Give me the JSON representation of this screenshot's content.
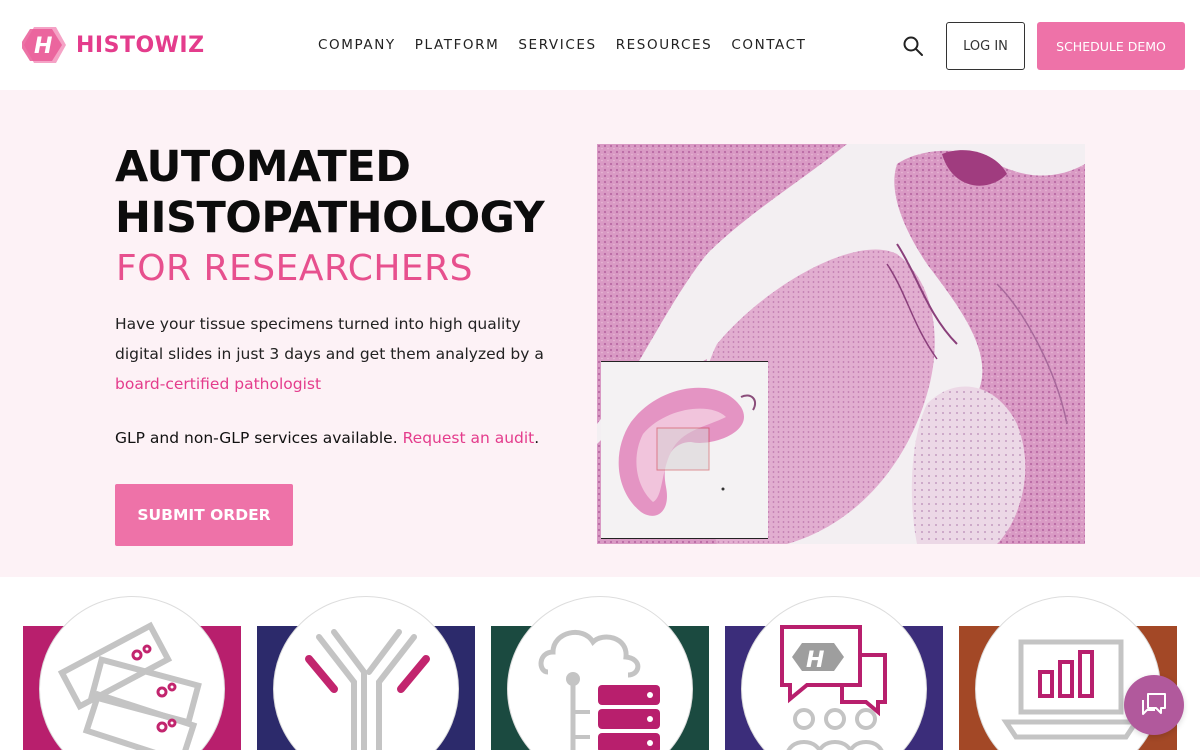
{
  "brand": {
    "name": "HISTOWIZ",
    "color": "#e43c8c"
  },
  "nav": {
    "items": [
      "COMPANY",
      "PLATFORM",
      "SERVICES",
      "RESOURCES",
      "CONTACT"
    ],
    "login_label": "LOG IN",
    "demo_label": "SCHEDULE DEMO"
  },
  "hero": {
    "title_line1": "AUTOMATED",
    "title_line2": "HISTOPATHOLOGY",
    "subtitle": "FOR RESEARCHERS",
    "description": "Have your tissue specimens turned into high quality digital slides in just 3 days and get them analyzed by a",
    "description_link": "board-certified pathologist",
    "glp_text": "GLP and non-GLP services available.",
    "glp_link": "Request an audit",
    "glp_end": ".",
    "submit_label": "SUBMIT ORDER",
    "accent_color": "#ee72a8"
  },
  "cards": [
    {
      "icon": "slides-icon",
      "color": "#b81f6d"
    },
    {
      "icon": "antibody-icon",
      "color": "#2c2a6b"
    },
    {
      "icon": "cloud-database-icon",
      "color": "#1b4a40"
    },
    {
      "icon": "consultation-icon",
      "color": "#3b2d7a"
    },
    {
      "icon": "analytics-laptop-icon",
      "color": "#a34826"
    }
  ],
  "chat": {
    "icon": "chat-icon",
    "color": "#b1599c"
  }
}
